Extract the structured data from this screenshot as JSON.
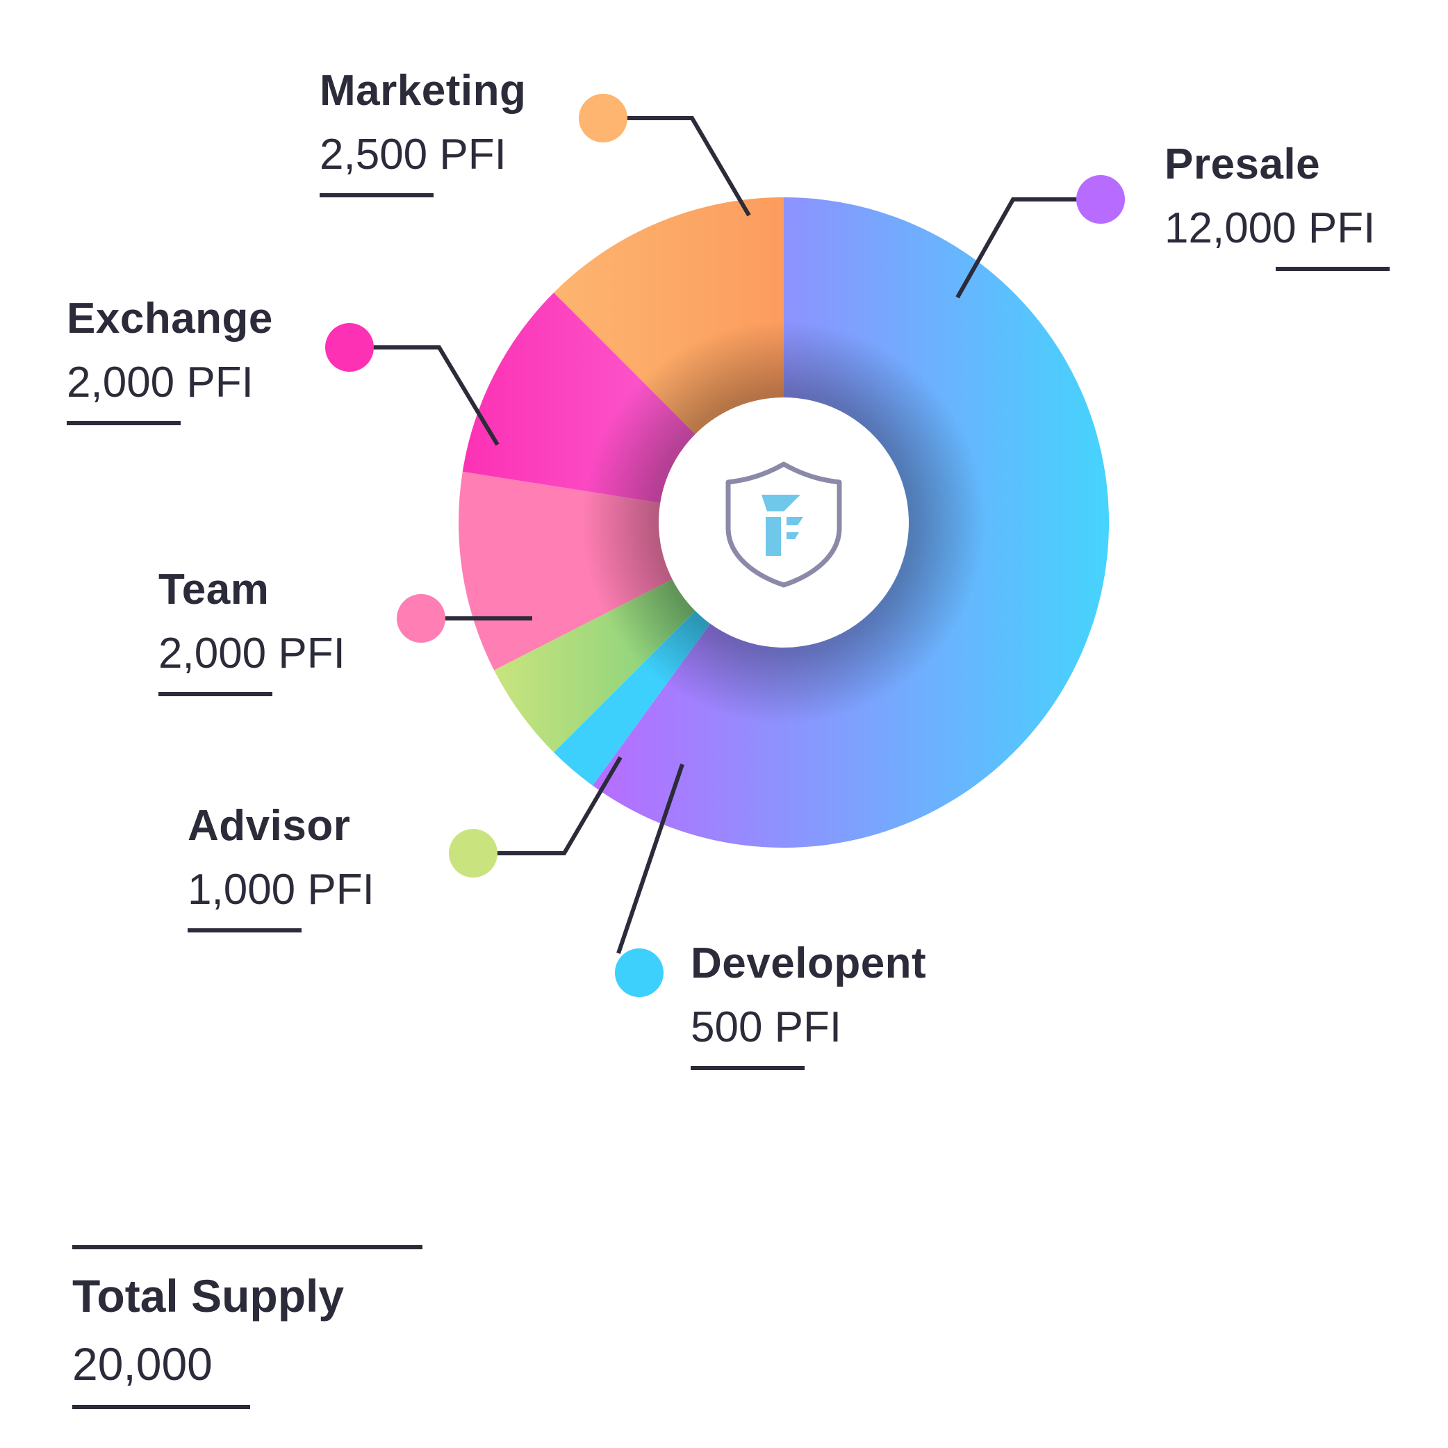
{
  "chart_data": {
    "type": "pie",
    "style": "donut",
    "unit": "PFI",
    "slices": [
      {
        "name": "Presale",
        "value": 12000,
        "value_label": "12,000 PFI",
        "color": "#b86cff",
        "color_end": "#45d4fd"
      },
      {
        "name": "Developent",
        "value": 500,
        "value_label": "500 PFI",
        "color": "#3dd0fc",
        "color_end": "#3dd0fc"
      },
      {
        "name": "Advisor",
        "value": 1000,
        "value_label": "1,000 PFI",
        "color": "#c9e47e",
        "color_end": "#7fcf7c"
      },
      {
        "name": "Team",
        "value": 2000,
        "value_label": "2,000 PFI",
        "color": "#ff7eb3",
        "color_end": "#ff7eb3"
      },
      {
        "name": "Exchange",
        "value": 2000,
        "value_label": "2,000 PFI",
        "color": "#fc31b4",
        "color_end": "#fb5dd0"
      },
      {
        "name": "Marketing",
        "value": 2500,
        "value_label": "2,500 PFI",
        "color": "#fdb56f",
        "color_end": "#fc9c5e"
      }
    ],
    "total": {
      "label": "Total Supply",
      "value": "20,000"
    },
    "center_icon": "shield-logo-icon",
    "accent_colors": {
      "text": "#2b2b3a",
      "shield_stroke": "#8a8aa8",
      "logo": "#6fc7ea"
    }
  }
}
